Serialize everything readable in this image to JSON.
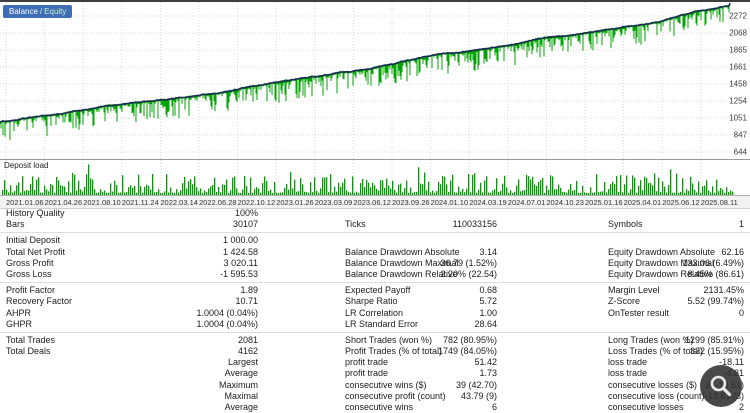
{
  "colors": {
    "legend_bg": "#3e6db5",
    "grid": "#d9d9d9",
    "axis_text": "#3c3c3c",
    "balance_line": "#1b2a55",
    "equity_line": "#00a400",
    "deposit_bar": "#009b00"
  },
  "legend": {
    "balance": "Balance",
    "separator": "/",
    "equity": "Equity"
  },
  "chart_data": {
    "type": "line",
    "title": "Balance / Equity",
    "x_ticks": [
      "2021.01.06",
      "2021.04.26",
      "2021.08.10",
      "2021.11.24",
      "2022.03.14",
      "2022.06.28",
      "2022.10.12",
      "2023.01.26",
      "2023.03.09",
      "2023.06.12",
      "2023.09.26",
      "2024.01.10",
      "2024.03.19",
      "2024.07.01",
      "2024.10.23",
      "2025.01.16",
      "2025.04.01",
      "2025.06.12",
      "2025.08.11"
    ],
    "y_ticks": [
      2272,
      2068,
      1865,
      1661,
      1458,
      1254,
      1051,
      847,
      644
    ],
    "y_range": [
      560,
      2440
    ],
    "grid": "dotted",
    "legend_position": "top-left",
    "series": [
      {
        "name": "Balance",
        "color": "#1b2a55",
        "start": 1000.0,
        "end": 2424.58,
        "shape": "smooth steadily rising line"
      },
      {
        "name": "Equity",
        "color": "#00a400",
        "start": 1000.0,
        "end": 2424.58,
        "shape": "noisy band around balance with downward spikes"
      }
    ],
    "sub_chart": {
      "name": "Deposit load",
      "type": "bar",
      "color": "#009b00",
      "description": "dense short green vertical bars along the bottom strip"
    }
  },
  "stats": {
    "rows": [
      [
        "History Quality",
        "100%",
        "",
        "",
        "",
        ""
      ],
      [
        "Bars",
        "30107",
        "Ticks",
        "110033156",
        "Symbols",
        "1"
      ],
      [
        "Initial Deposit",
        "1 000.00",
        "",
        "",
        "",
        ""
      ],
      [
        "Total Net Profit",
        "1 424.58",
        "Balance Drawdown Absolute",
        "3.14",
        "Equity Drawdown Absolute",
        "62.16"
      ],
      [
        "Gross Profit",
        "3 020.11",
        "Balance Drawdown Maximal",
        "36.79 (1.52%)",
        "Equity Drawdown Maximal",
        "133.06 (6.49%)"
      ],
      [
        "Gross Loss",
        "-1 595.53",
        "Balance Drawdown Relative",
        "2.20% (22.54)",
        "Equity Drawdown Relative",
        "8.45% (86.61)"
      ],
      [
        "Profit Factor",
        "1.89",
        "Expected Payoff",
        "0.68",
        "Margin Level",
        "2131.45%"
      ],
      [
        "Recovery Factor",
        "10.71",
        "Sharpe Ratio",
        "5.72",
        "Z-Score",
        "5.52 (99.74%)"
      ],
      [
        "AHPR",
        "1.0004 (0.04%)",
        "LR Correlation",
        "1.00",
        "OnTester result",
        "0"
      ],
      [
        "GHPR",
        "1.0004 (0.04%)",
        "LR Standard Error",
        "28.64",
        "",
        ""
      ],
      [
        "Total Trades",
        "2081",
        "Short Trades (won %)",
        "782 (80.95%)",
        "Long Trades (won %)",
        "1299 (85.91%)"
      ],
      [
        "Total Deals",
        "4162",
        "Profit Trades (% of total)",
        "1749 (84.05%)",
        "Loss Trades (% of total)",
        "332 (15.95%)"
      ],
      [
        "",
        "Largest",
        "profit trade",
        "51.42",
        "loss trade",
        "-18.11"
      ],
      [
        "",
        "Average",
        "profit trade",
        "1.73",
        "loss trade",
        "-4.81"
      ],
      [
        "",
        "Maximum",
        "consecutive wins ($)",
        "39 (42.70)",
        "consecutive losses ($)",
        "3 (-13.61)"
      ],
      [
        "",
        "Maximal",
        "consecutive profit (count)",
        "43.79 (9)",
        "consecutive loss (count)",
        "-13.61 (3)"
      ],
      [
        "",
        "Average",
        "consecutive wins",
        "6",
        "consecutive losses",
        "2"
      ]
    ],
    "separators_after": [
      1,
      5,
      9
    ]
  }
}
